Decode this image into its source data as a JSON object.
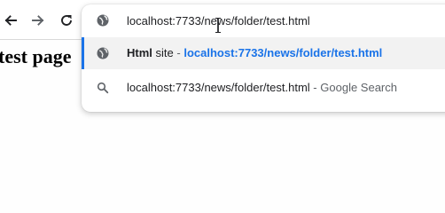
{
  "omnibox": {
    "input_text": "localhost:7733/news/folder/test.html",
    "suggestions": [
      {
        "title": "Html",
        "subtitle": "site",
        "separator": "-",
        "url": "localhost:7733/news/folder/test.html"
      },
      {
        "query": "localhost:7733/news/folder/test.html",
        "separator": "-",
        "engine": "Google Search"
      }
    ]
  },
  "page": {
    "heading": "test page"
  },
  "colors": {
    "accent": "#1a73e8",
    "selected_row": "#f2f2f2"
  }
}
